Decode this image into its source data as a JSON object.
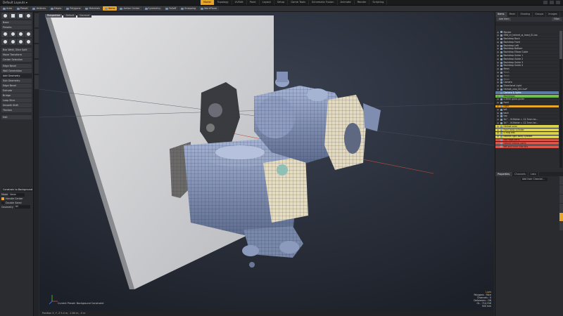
{
  "app": {
    "layout_label": "Default Layouts ▾",
    "tabs": [
      {
        "label": "Model",
        "active": true
      },
      {
        "label": "Topology",
        "active": false
      },
      {
        "label": "UVEdit",
        "active": false
      },
      {
        "label": "Paint",
        "active": false
      },
      {
        "label": "Layout",
        "active": false
      },
      {
        "label": "Setup",
        "active": false
      },
      {
        "label": "Game Tools",
        "active": false
      },
      {
        "label": "Schematic Fusion",
        "active": false
      },
      {
        "label": "Animate",
        "active": false
      },
      {
        "label": "Render",
        "active": false
      },
      {
        "label": "Scripting",
        "active": false
      }
    ]
  },
  "toolbar": {
    "buttons": [
      {
        "label": "Auto",
        "selected": false
      },
      {
        "label": "Preset",
        "selected": false
      },
      {
        "label": "Vertices",
        "selected": false
      },
      {
        "label": "Edges",
        "selected": false
      },
      {
        "label": "Polygons",
        "selected": false
      },
      {
        "label": "Materials",
        "selected": false
      },
      {
        "label": "Items",
        "selected": true
      },
      {
        "label": "Action Center",
        "selected": false
      },
      {
        "label": "Symmetry",
        "selected": false
      },
      {
        "label": "Falloff",
        "selected": false
      },
      {
        "label": "Snapping",
        "selected": false
      },
      {
        "label": "WorkPlane",
        "selected": false
      }
    ]
  },
  "left_panel": {
    "buttons_a": [
      "Basic",
      "Presets"
    ],
    "buttons_b": [
      "Box Weld, Slice Split",
      "Move Transform",
      "Center Selection"
    ],
    "buttons_c": [
      "Edge Bevel",
      "Wall Generation"
    ],
    "header": "Add Geometry",
    "buttons_d": [
      "Sub Geometry",
      "Edge Bevel",
      "Extrude",
      "Bridge",
      "Loop Slice",
      "Smooth Shift",
      "Thicken"
    ],
    "dropdown": "Edit",
    "section_title": "Constrain to Background",
    "mode_label": "Mode",
    "mode_value": "None",
    "handle_label": "Handle Center",
    "double_label": "Double Sided",
    "geometry_label": "Geometry",
    "geometry_value": "All"
  },
  "viewport": {
    "tabs": [
      "Perspective",
      "Default",
      "Gouraud"
    ],
    "active_tab": "Perspective",
    "bottom_label": "Current Preset: Background Constraint",
    "info": {
      "title": "Light",
      "line1": "Polygons : Face",
      "line2": "Channels : 0",
      "line3": "Deformers : ON",
      "line4": "GL : 714,316",
      "line5": "500 mm"
    }
  },
  "status_bar": "Position X, Y, Z    5.4 m, -2.84 m, -5 m",
  "right_panel": {
    "tabs": [
      "Items",
      "Mesh",
      "Shading",
      "Groups",
      "Images"
    ],
    "active_tab": "Items",
    "add_item": "Add Item",
    "filter": "Filter",
    "items": [
      {
        "label": "Render",
        "style": ""
      },
      {
        "label": "SBN_trl_helmet_w_head_01.lxo",
        "style": ""
      },
      {
        "label": "Backdrop Back",
        "style": ""
      },
      {
        "label": "Backdrop Front",
        "style": ""
      },
      {
        "label": "Backdrop Left",
        "style": ""
      },
      {
        "label": "Backdrop Bottom",
        "style": ""
      },
      {
        "label": "Backdrop Elbow Guide",
        "style": ""
      },
      {
        "label": "Backdrop Guide 1",
        "style": ""
      },
      {
        "label": "Backdrop Guide 2",
        "style": ""
      },
      {
        "label": "Backdrop Guide 3",
        "style": ""
      },
      {
        "label": "Backdrop Guide 4",
        "style": ""
      },
      {
        "label": "Mesh",
        "style": ""
      },
      {
        "label": "Mesh",
        "style": "dim"
      },
      {
        "label": "Mesh",
        "style": "dim"
      },
      {
        "label": "Mesh",
        "style": "dim"
      },
      {
        "label": "Camera",
        "style": ""
      },
      {
        "label": "Directional Light",
        "style": ""
      },
      {
        "label": "Helmet_new_001.lxo*",
        "style": ""
      },
      {
        "label": "Camera & lights",
        "style": "sel-blue"
      },
      {
        "label": "Backdrops",
        "style": "sel-green"
      },
      {
        "label": "0.5mm glass guide",
        "style": ""
      },
      {
        "label": "front",
        "style": ""
      },
      {
        "label": "Light",
        "style": "sel-orange"
      },
      {
        "label": "left",
        "style": ""
      },
      {
        "label": "back",
        "style": ""
      },
      {
        "label": "top",
        "style": ""
      },
      {
        "label": "3d '' - M-Mdrier = 12.7mm ter...",
        "style": ""
      },
      {
        "label": "3d '' - M-Mdrier = 12.7mm ter...",
        "style": ""
      },
      {
        "label": "Helmet scan",
        "style": "sel-yellow"
      },
      {
        "label": "front body cylinder",
        "style": "sel-yellow"
      },
      {
        "label": "O ring dial",
        "style": "sel-yellow"
      },
      {
        "label": "helmet right body cylinder",
        "style": "sel-yellow"
      },
      {
        "label": "top ridge parts",
        "style": "sel-red"
      },
      {
        "label": "helmet interior parts",
        "style": "sel-red"
      },
      {
        "label": "left and inner side bits",
        "style": "sel-red"
      }
    ],
    "bottom_tabs": [
      "Properties",
      "Channels",
      "Lists"
    ],
    "bottom_active": "Properties",
    "bottom_tag": "Add User Channel..."
  }
}
